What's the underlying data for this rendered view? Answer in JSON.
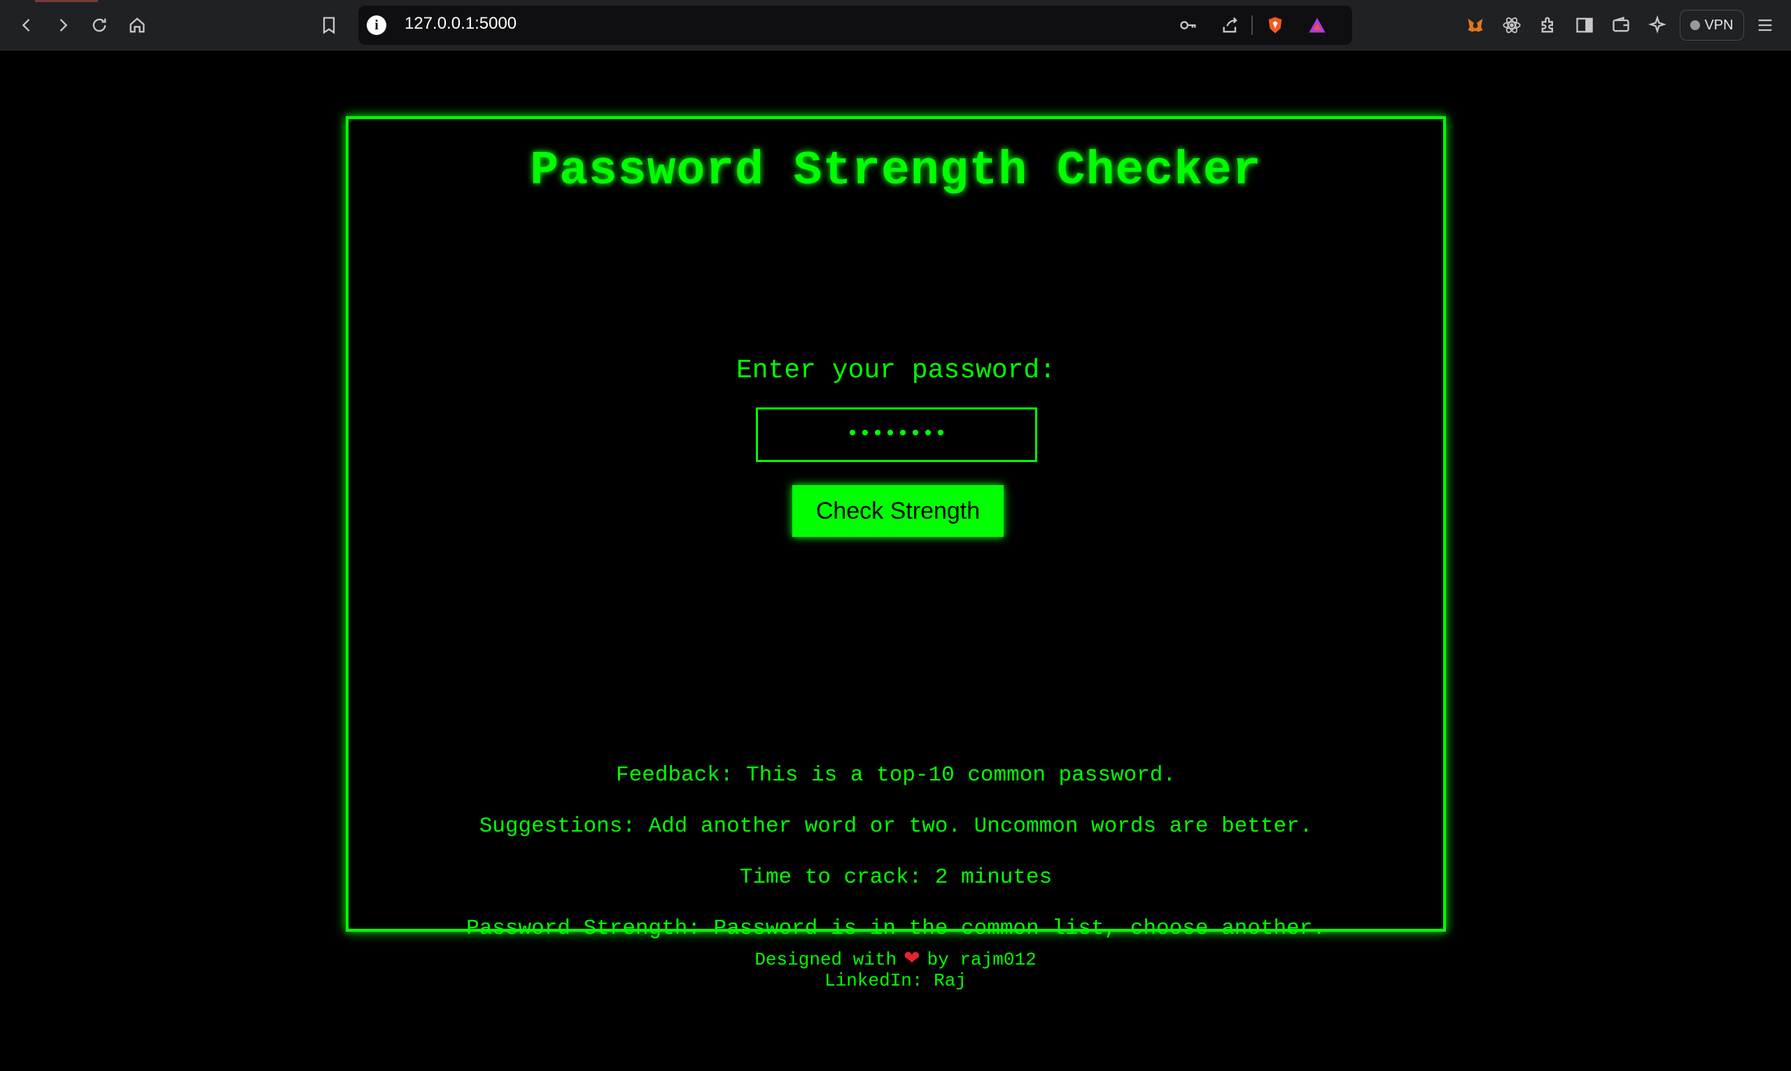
{
  "browser": {
    "url": "127.0.0.1:5000",
    "vpn_label": "VPN"
  },
  "app": {
    "title": "Password Strength Checker",
    "prompt_label": "Enter your password:",
    "password_value": "••••••••",
    "check_button_label": "Check Strength"
  },
  "results": {
    "feedback": "Feedback: This is a top-10 common password.",
    "suggestions": "Suggestions: Add another word or two. Uncommon words are better.",
    "time_to_crack": "Time to crack: 2 minutes",
    "strength": "Password Strength: Password is in the common list, choose another."
  },
  "footer": {
    "designed_prefix": "Designed with",
    "heart": "❤",
    "designed_suffix": "by rajm012",
    "linkedin": "LinkedIn: Raj"
  },
  "colors": {
    "accent_green": "#00ff00",
    "background": "#000000",
    "chrome": "#202124"
  }
}
